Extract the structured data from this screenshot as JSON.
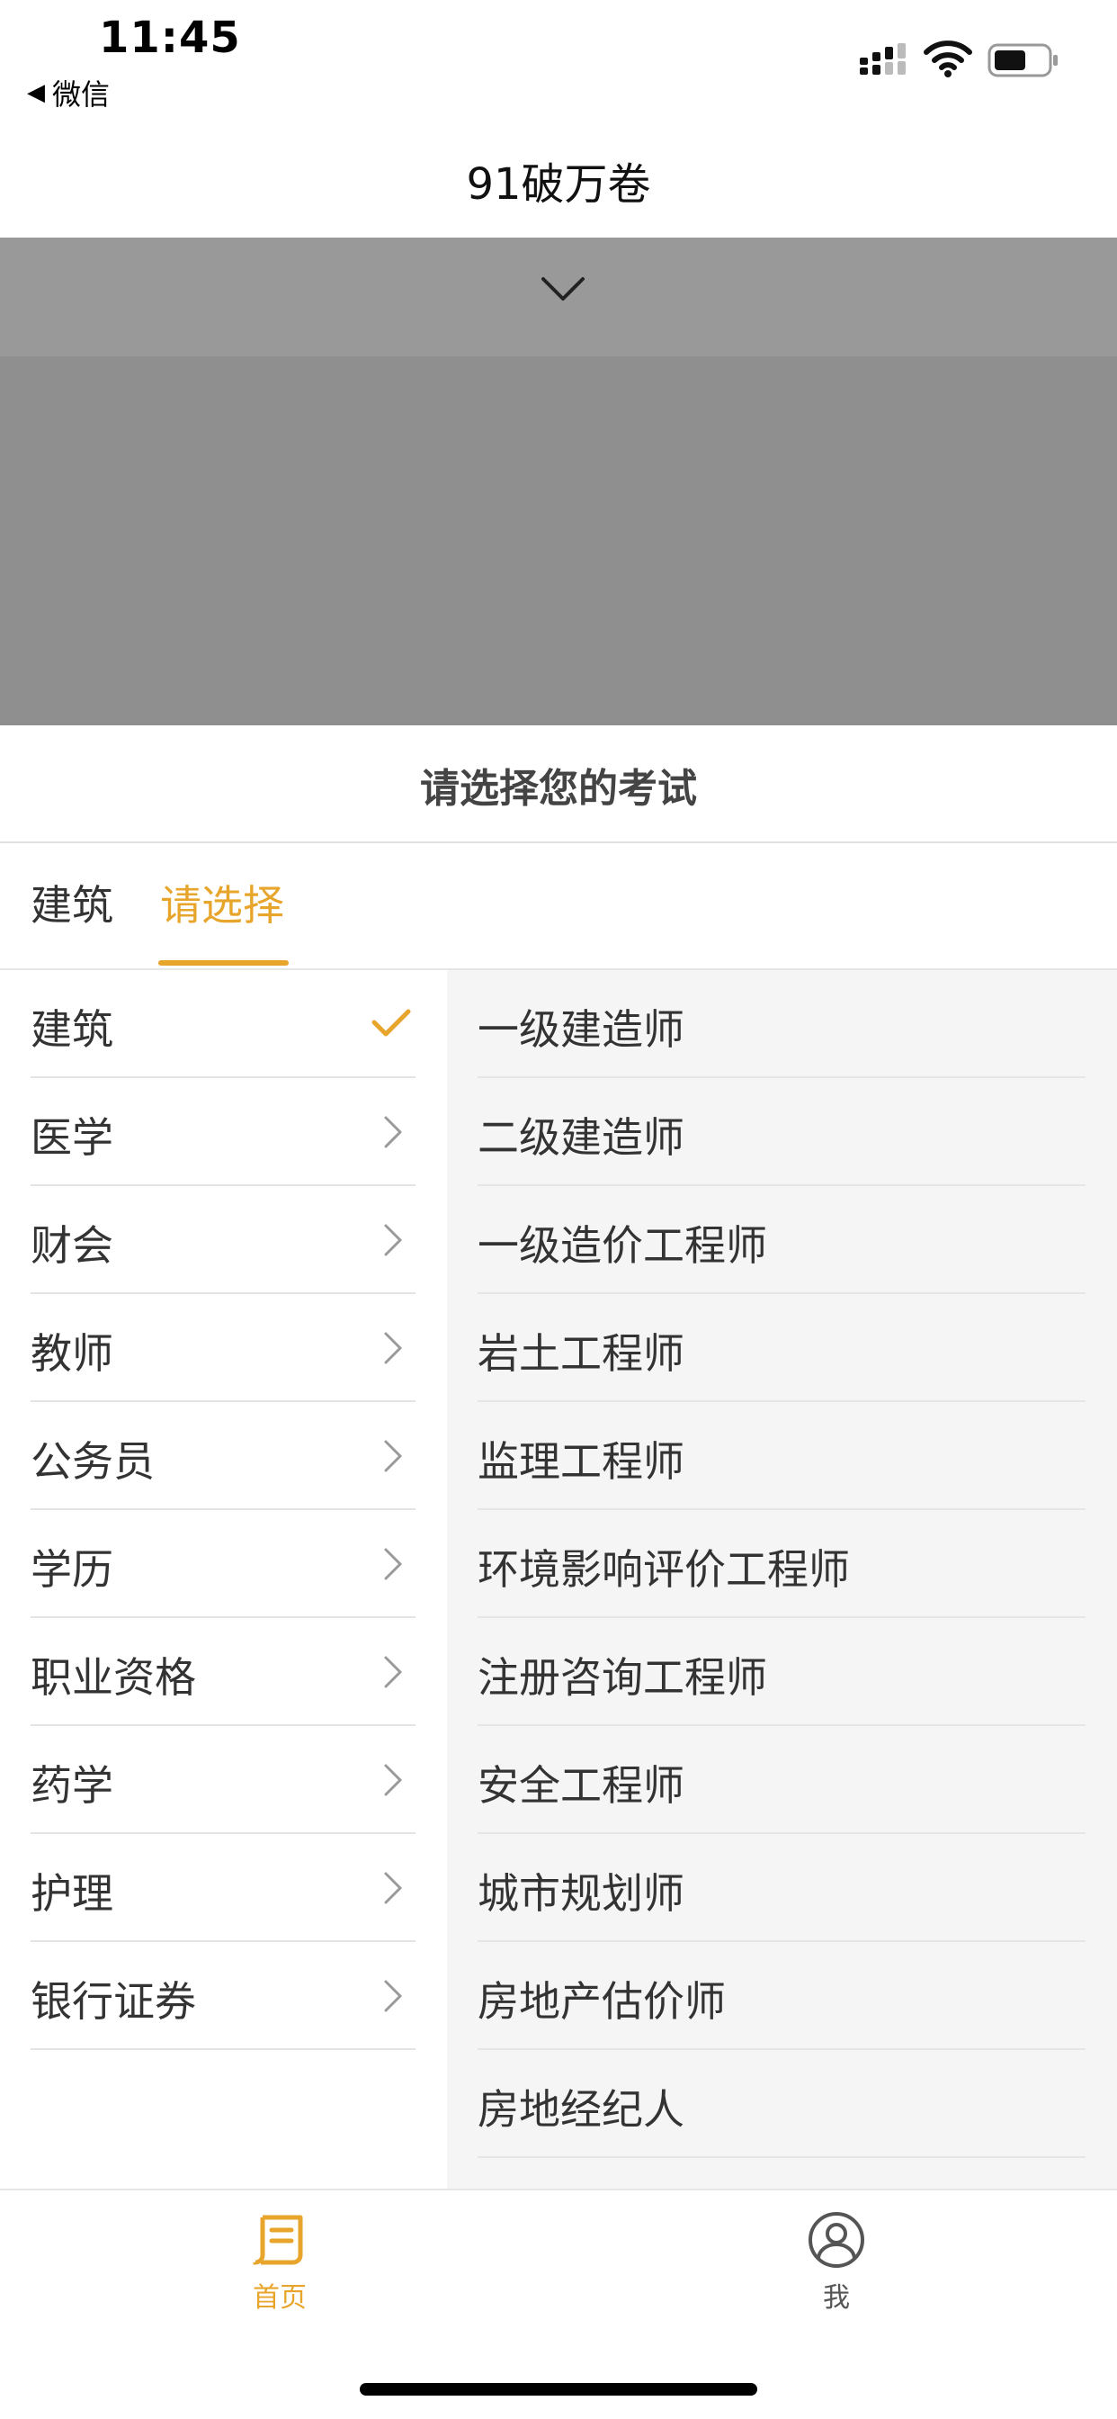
{
  "status_bar": {
    "time": "11:45",
    "back_label": "微信"
  },
  "nav": {
    "title": "91破万卷"
  },
  "sheet": {
    "title": "请选择您的考试",
    "tabs": [
      {
        "label": "建筑",
        "active": false
      },
      {
        "label": "请选择",
        "active": true
      }
    ],
    "categories": [
      {
        "label": "建筑",
        "selected": true
      },
      {
        "label": "医学",
        "selected": false
      },
      {
        "label": "财会",
        "selected": false
      },
      {
        "label": "教师",
        "selected": false
      },
      {
        "label": "公务员",
        "selected": false
      },
      {
        "label": "学历",
        "selected": false
      },
      {
        "label": "职业资格",
        "selected": false
      },
      {
        "label": "药学",
        "selected": false
      },
      {
        "label": "护理",
        "selected": false
      },
      {
        "label": "银行证券",
        "selected": false
      }
    ],
    "exams": [
      "一级建造师",
      "二级建造师",
      "一级造价工程师",
      "岩土工程师",
      "监理工程师",
      "环境影响评价工程师",
      "注册咨询工程师",
      "安全工程师",
      "城市规划师",
      "房地产估价师",
      "房地经纪人"
    ]
  },
  "tabbar": {
    "home_label": "首页",
    "me_label": "我"
  },
  "colors": {
    "accent": "#e8a52c",
    "overlay": "#8f8f8f",
    "panel_bg": "#f5f5f5"
  },
  "icons": {
    "check": "checkmark-icon",
    "chevron": "chevron-right-icon",
    "collapse": "chevron-down-icon",
    "home": "scroll-document-icon",
    "me": "user-circle-icon"
  }
}
